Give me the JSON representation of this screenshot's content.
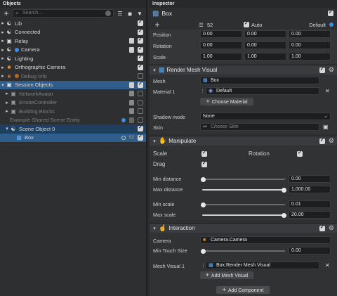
{
  "objects": {
    "title": "Objects",
    "search_placeholder": "Search...",
    "items": [
      {
        "label": "Lib"
      },
      {
        "label": "Connected"
      },
      {
        "label": "Relay"
      },
      {
        "label": "Camera"
      },
      {
        "label": "Lighting"
      },
      {
        "label": "Orthographic Camera"
      },
      {
        "label": "Debug Info"
      },
      {
        "label": "Session Objects"
      },
      {
        "label": "NetworkAvatar"
      },
      {
        "label": "EmoteController"
      },
      {
        "label": "Building Blocks"
      },
      {
        "label": "Example Shared Scene Entity"
      },
      {
        "label": "Scene Object 0"
      },
      {
        "label": "Box"
      }
    ],
    "layer_badge_box": "52"
  },
  "inspector": {
    "title": "Inspector",
    "object_name": "Box",
    "layer": "52",
    "auto_label": "Auto",
    "default_label": "Default",
    "transform": {
      "position_label": "Position",
      "position": [
        "0.00",
        "0.00",
        "0.00"
      ],
      "rotation_label": "Rotation",
      "rotation": [
        "0.00",
        "0.00",
        "0.00"
      ],
      "scale_label": "Scale",
      "scale": [
        "1.00",
        "1.00",
        "1.00"
      ]
    },
    "render_mesh": {
      "title": "Render Mesh Visual",
      "mesh_label": "Mesh",
      "mesh_value": "Box",
      "material_label": "Material 1",
      "material_value": "Default",
      "choose_material": "Choose Material",
      "shadow_label": "Shadow mode",
      "shadow_value": "None",
      "skin_label": "Skin",
      "skin_placeholder": "Choose Skin"
    },
    "manipulate": {
      "title": "Manipulate",
      "scale_label": "Scale",
      "rotation_label": "Rotation",
      "drag_label": "Drag",
      "min_distance_label": "Min distance",
      "min_distance": "0.00",
      "max_distance_label": "Max distance",
      "max_distance": "1,000.00",
      "min_scale_label": "Min scale",
      "min_scale": "0.01",
      "max_scale_label": "Max scale",
      "max_scale": "20.00"
    },
    "interaction": {
      "title": "Interaction",
      "camera_label": "Camera",
      "camera_value": "Camera.Camera",
      "min_touch_label": "Min Touch Size",
      "min_touch": "0.00",
      "mesh_visual_label": "Mesh Visual 1",
      "mesh_visual_value": "Box.Render Mesh Visual",
      "add_mesh_visual": "Add Mesh Visual"
    },
    "add_component": "Add Component"
  },
  "colors": {
    "accent": "#2f5d8c",
    "orange": "#e08a2a",
    "blue": "#3a8ee6"
  }
}
